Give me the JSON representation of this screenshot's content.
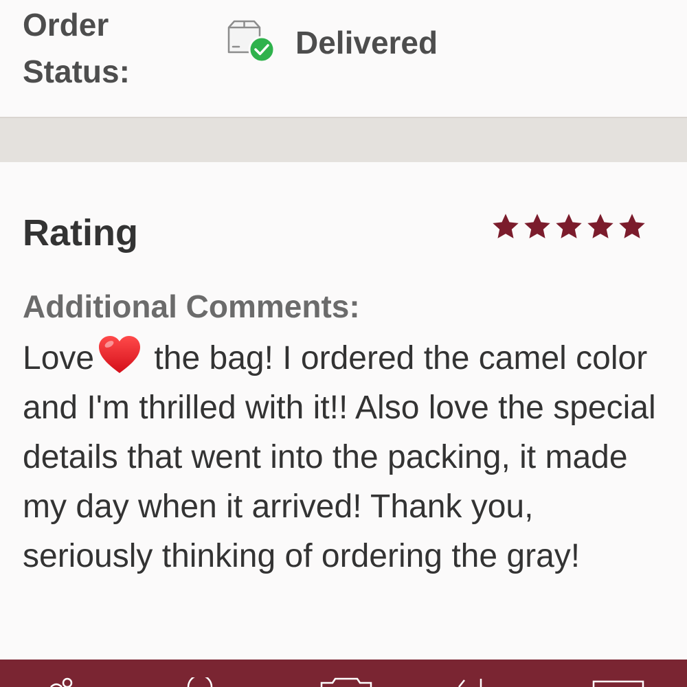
{
  "order_status": {
    "label_line1": "Order",
    "label_line2": "Status:",
    "icon": "box-delivered-icon",
    "value": "Delivered",
    "check_color": "#2fb24c"
  },
  "review": {
    "rating_label": "Rating",
    "rating_value": 5,
    "rating_max": 5,
    "star_color": "#7b1c2c",
    "comments_label": "Additional Comments:",
    "comment_before_heart": "Love",
    "heart_icon": "red-heart-icon",
    "comment_after_heart": " the bag! I ordered the camel color and I'm thrilled with it!! Also love the special details that went into the packing, it made my day when it arrived! Thank you, seriously thinking of ordering the gray!"
  },
  "bottom_nav": {
    "background_color": "#7a2532",
    "icons": [
      "people-icon",
      "search-icon",
      "camera-icon",
      "tag-icon",
      "card-icon"
    ]
  }
}
